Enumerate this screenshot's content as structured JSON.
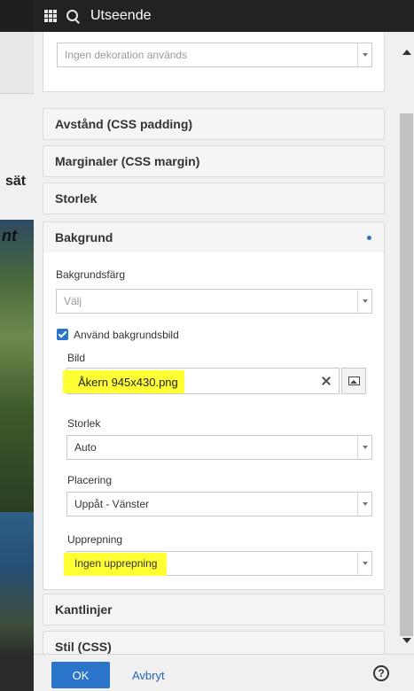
{
  "header": {
    "title": "Utseende"
  },
  "decoration": {
    "value": "Ingen dekoration används"
  },
  "sections": {
    "padding": "Avstånd (CSS padding)",
    "margin": "Marginaler (CSS margin)",
    "size": "Storlek",
    "background": "Bakgrund",
    "borders": "Kantlinjer",
    "style": "Stil (CSS)"
  },
  "background": {
    "color_label": "Bakgrundsfärg",
    "color_value": "Välj",
    "use_image_label": "Använd bakgrundsbild",
    "use_image_checked": true,
    "image_label": "Bild",
    "image_value": "Åkern  945x430.png",
    "size_label": "Storlek",
    "size_value": "Auto",
    "position_label": "Placering",
    "position_value": "Uppåt - Vänster",
    "repeat_label": "Upprepning",
    "repeat_value": "Ingen upprepning",
    "active_dot_color": "#2a74c9"
  },
  "footer": {
    "ok_label": "OK",
    "cancel_label": "Avbryt",
    "help_icon": "?"
  },
  "background_page": {
    "text1": "sät",
    "text2": "nt"
  },
  "colors": {
    "accent": "#2a74c9",
    "highlight": "#ffff33",
    "titlebar": "#222222"
  }
}
